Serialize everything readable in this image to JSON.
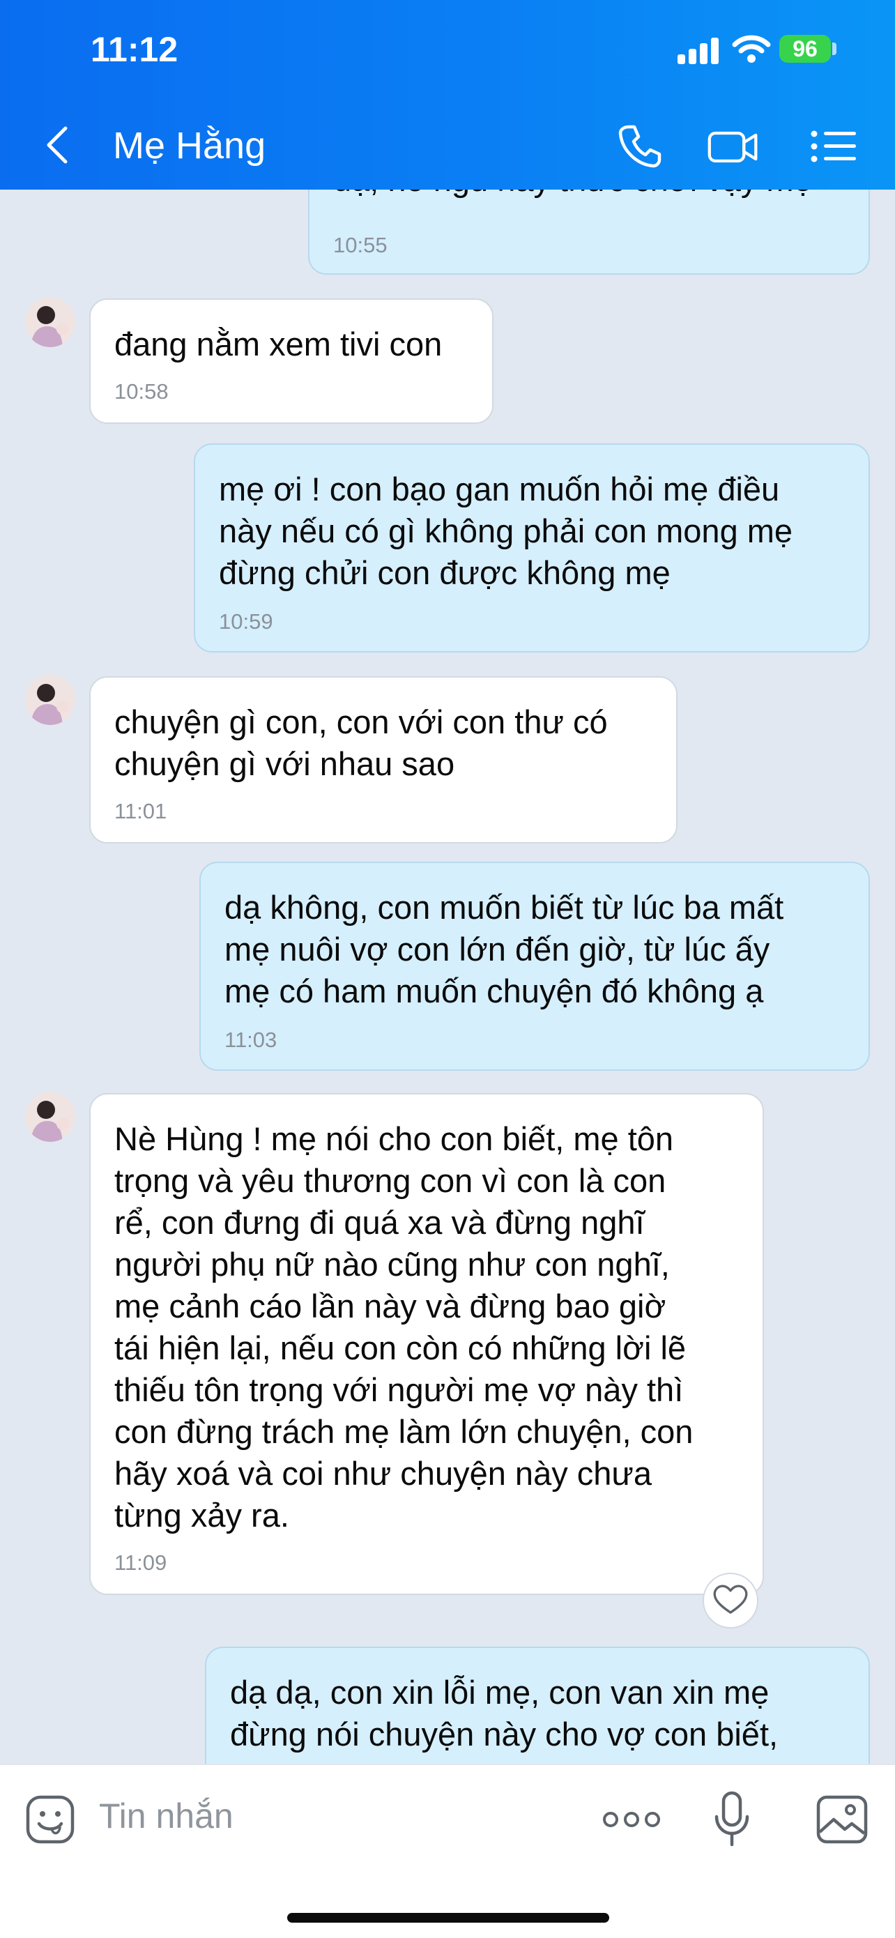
{
  "status_bar": {
    "time": "11:12",
    "battery": "96"
  },
  "header": {
    "contact_name": "Mẹ Hằng"
  },
  "messages": [
    {
      "direction": "out",
      "text": "dạ, nó ngủ hay thức chơi vậy mẹ",
      "time": "10:55"
    },
    {
      "direction": "in",
      "text": "đang nằm xem tivi con",
      "time": "10:58"
    },
    {
      "direction": "out",
      "text": "mẹ ơi ! con bạo gan muốn hỏi mẹ điều\nnày nếu có gì không phải con mong mẹ\nđừng chửi con được không mẹ",
      "time": "10:59"
    },
    {
      "direction": "in",
      "text": "chuyện gì con, con với con thư có\nchuyện gì với nhau sao",
      "time": "11:01"
    },
    {
      "direction": "out",
      "text": "dạ không, con muốn biết từ lúc ba mất\nmẹ nuôi vợ con lớn đến giờ, từ lúc ấy\nmẹ có ham muốn chuyện đó không ạ",
      "time": "11:03"
    },
    {
      "direction": "in",
      "text": "Nè Hùng ! mẹ nói cho con biết, mẹ tôn\ntrọng và yêu thương con vì con là con\nrể, con đưng đi quá xa và đừng nghĩ\nngười phụ nữ nào cũng như con nghĩ,\nmẹ cảnh cáo lần này và đừng bao giờ\ntái hiện lại, nếu con còn có những lời lẽ\nthiếu tôn trọng với người mẹ vợ này thì\ncon đừng trách mẹ làm lớn chuyện, con\nhãy xoá và coi như chuyện này chưa\ntừng xảy ra.",
      "time": "11:09"
    },
    {
      "direction": "out",
      "text": "dạ dạ, con xin lỗi mẹ, con van xin mẹ\nđừng nói chuyện này cho vợ con biết,",
      "time": ""
    }
  ],
  "input": {
    "placeholder": "Tin nhắn"
  },
  "icons": {
    "back": "chevron-left-icon",
    "call": "phone-icon",
    "video": "video-camera-icon",
    "menu": "list-menu-icon",
    "sticker": "sticker-icon",
    "more": "more-dots-icon",
    "voice": "microphone-icon",
    "image": "image-icon",
    "react": "heart-icon"
  },
  "colors": {
    "header": "#0a7ff4",
    "outgoing_bubble": "#d5effd",
    "incoming_bubble": "#ffffff",
    "chat_background": "#e2e8f1",
    "battery": "#38d34c"
  }
}
